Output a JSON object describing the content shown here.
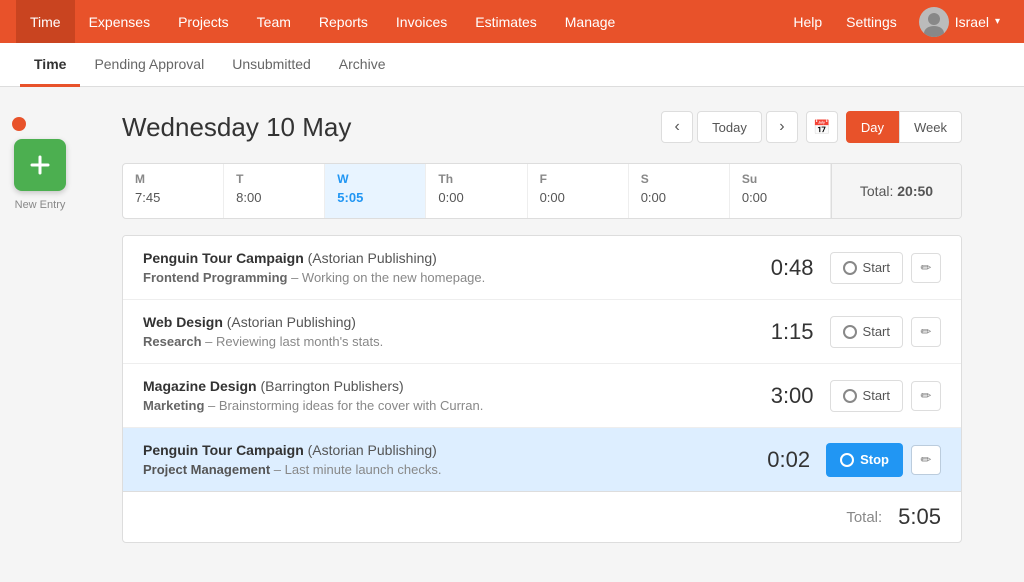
{
  "nav": {
    "items": [
      {
        "label": "Time",
        "active": true
      },
      {
        "label": "Expenses",
        "active": false
      },
      {
        "label": "Projects",
        "active": false
      },
      {
        "label": "Team",
        "active": false
      },
      {
        "label": "Reports",
        "active": false
      },
      {
        "label": "Invoices",
        "active": false
      },
      {
        "label": "Estimates",
        "active": false
      },
      {
        "label": "Manage",
        "active": false
      }
    ],
    "right": [
      {
        "label": "Help"
      },
      {
        "label": "Settings"
      }
    ],
    "user": "Israel"
  },
  "subnav": {
    "items": [
      {
        "label": "Time",
        "active": true
      },
      {
        "label": "Pending Approval",
        "active": false
      },
      {
        "label": "Unsubmitted",
        "active": false
      },
      {
        "label": "Archive",
        "active": false
      }
    ]
  },
  "page": {
    "title_day": "Wednesday",
    "title_date": "10 May",
    "today_label": "Today",
    "day_label": "Day",
    "week_label": "Week"
  },
  "week_grid": {
    "days": [
      {
        "abbr": "M",
        "time": "7:45",
        "active": false
      },
      {
        "abbr": "T",
        "time": "8:00",
        "active": false
      },
      {
        "abbr": "W",
        "time": "5:05",
        "active": true
      },
      {
        "abbr": "Th",
        "time": "0:00",
        "active": false
      },
      {
        "abbr": "F",
        "time": "0:00",
        "active": false
      },
      {
        "abbr": "S",
        "time": "0:00",
        "active": false
      },
      {
        "abbr": "Su",
        "time": "0:00",
        "active": false
      }
    ],
    "total_label": "Total:",
    "total_value": "20:50"
  },
  "entries": [
    {
      "project": "Penguin Tour Campaign",
      "client": "(Astorian Publishing)",
      "task": "Frontend Programming",
      "description": "Working on the new homepage.",
      "duration": "0:48",
      "running": false
    },
    {
      "project": "Web Design",
      "client": "(Astorian Publishing)",
      "task": "Research",
      "description": "Reviewing last month's stats.",
      "duration": "1:15",
      "running": false
    },
    {
      "project": "Magazine Design",
      "client": "(Barrington Publishers)",
      "task": "Marketing",
      "description": "Brainstorming ideas for the cover with Curran.",
      "duration": "3:00",
      "running": false
    },
    {
      "project": "Penguin Tour Campaign",
      "client": "(Astorian Publishing)",
      "task": "Project Management",
      "description": "Last minute launch checks.",
      "duration": "0:02",
      "running": true
    }
  ],
  "total": {
    "label": "Total:",
    "value": "5:05"
  },
  "new_entry": {
    "label": "New Entry"
  },
  "buttons": {
    "start": "Start",
    "stop": "Stop",
    "prev_icon": "‹",
    "next_icon": "›"
  }
}
